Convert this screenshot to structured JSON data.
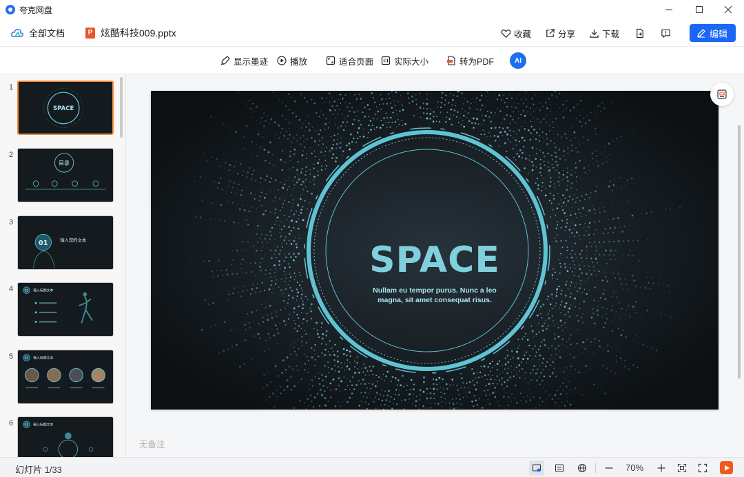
{
  "window": {
    "title": "夸克网盘"
  },
  "header": {
    "breadcrumb_home": "全部文档",
    "file_name": "炫酷科技009.pptx",
    "file_badge": "P",
    "actions": {
      "favorite": "收藏",
      "share": "分享",
      "download": "下载",
      "edit": "编辑"
    }
  },
  "toolbar": {
    "show_ink": "显示墨迹",
    "play": "播放",
    "fit_page": "适合页面",
    "actual_size": "实际大小",
    "to_pdf": "转为PDF",
    "ai": "AI"
  },
  "sidebar": {
    "slides": [
      {
        "num": "1",
        "title": "SPACE"
      },
      {
        "num": "2",
        "title": "目录"
      },
      {
        "num": "3",
        "title": "01",
        "caption": "输入您的文本"
      },
      {
        "num": "4",
        "title": "01",
        "caption": "输入标题文本"
      },
      {
        "num": "5",
        "title": "01",
        "caption": "输入标题文本"
      },
      {
        "num": "6",
        "title": "01",
        "caption": "输入标题文本"
      }
    ]
  },
  "slide": {
    "title": "SPACE",
    "subtitle_line1": "Nullam eu tempor purus. Nunc a leo",
    "subtitle_line2": "magna, sit amet consequat risus."
  },
  "notes": {
    "placeholder": "无备注"
  },
  "status": {
    "slide_count": "幻灯片 1/33",
    "zoom": "70%"
  },
  "colors": {
    "accent": "#1a66f5",
    "active_thumb": "#f08a3c",
    "slide_title": "#7fd0dc",
    "ring": "#5fc3d3"
  }
}
